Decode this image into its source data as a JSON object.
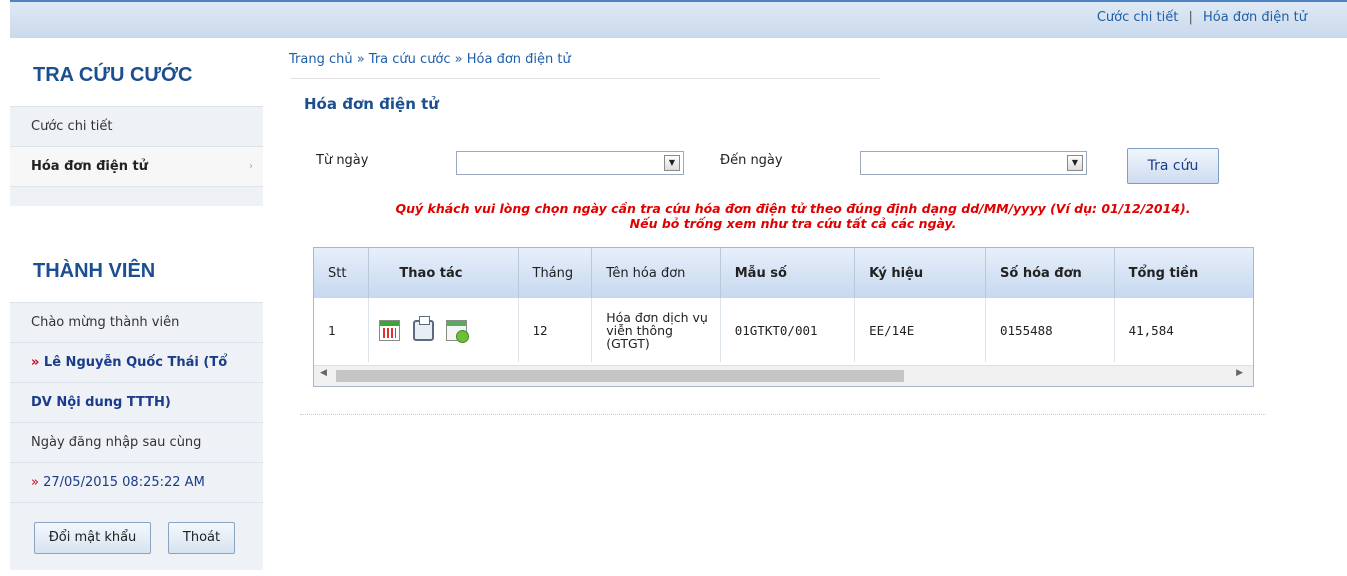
{
  "toplinks": {
    "detail": "Cước chi tiết",
    "sep": "|",
    "invoice": "Hóa đơn điện tử"
  },
  "sidebar": {
    "lookup_title": "TRA CỨU CƯỚC",
    "lookup_items": [
      {
        "label": "Cước chi tiết"
      },
      {
        "label": "Hóa đơn điện tử",
        "arrow": "›"
      }
    ],
    "member_title": "THÀNH VIÊN",
    "welcome": "Chào mừng thành viên",
    "raquo": "»",
    "member_name_1": " Lê Nguyễn Quốc Thái (Tổ",
    "member_name_2": "DV Nội dung TTTH)",
    "last_login_label": "Ngày đăng nhập sau cùng",
    "last_login_time": " 27/05/2015 08:25:22 AM",
    "change_password": "Đổi mật khẩu",
    "logout": "Thoát"
  },
  "breadcrumb": "Trang chủ » Tra cứu cước » Hóa đơn điện tử",
  "panel_title": "Hóa đơn điện tử",
  "form": {
    "from_label": "Từ ngày",
    "from_value": "",
    "to_label": "Đến ngày",
    "to_value": "",
    "search_button": "Tra cứu",
    "dropdown_arrow": "▼"
  },
  "note_line1": "Quý khách vui lòng chọn ngày cần tra cứu hóa đơn điện tử theo đúng định dạng dd/MM/yyyy (Ví dụ: 01/12/2014).",
  "note_line2": "Nếu bỏ trống xem như tra cứu tất cả các ngày.",
  "table": {
    "headers": [
      "Stt",
      "Thao tác",
      "Tháng",
      "Tên hóa đơn",
      "Mẫu số",
      "Ký hiệu",
      "Số hóa đơn",
      "Tổng tiền"
    ],
    "rows": [
      {
        "stt": "1",
        "actions": [
          "calendar-icon",
          "printer-icon",
          "download-icon"
        ],
        "month": "12",
        "name": "Hóa đơn dịch vụ viễn thông (GTGT)",
        "form_no": "01GTKT0/001",
        "symbol": "EE/14E",
        "invoice_no": "0155488",
        "total": "41,584"
      }
    ],
    "scroll_left": "◀",
    "scroll_right": "▶"
  }
}
